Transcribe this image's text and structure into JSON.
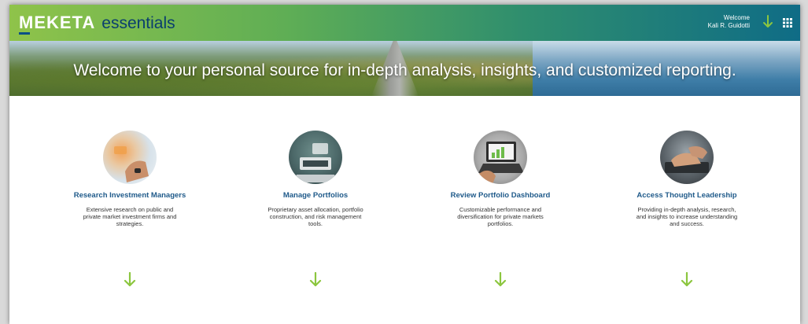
{
  "header": {
    "brand": "MEKETA",
    "product": "essentials",
    "welcome_label": "Welcome",
    "user_name": "Kali R. Guidotti"
  },
  "hero": {
    "title": "Welcome to your personal source for in-depth analysis, insights, and customized reporting."
  },
  "cards": [
    {
      "title": "Research Investment Managers",
      "description": "Extensive research on public and private market investment firms and strategies."
    },
    {
      "title": "Manage Portfolios",
      "description": "Proprietary asset allocation, portfolio construction, and risk management tools."
    },
    {
      "title": "Review Portfolio Dashboard",
      "description": "Customizable performance and diversification for private markets portfolios."
    },
    {
      "title": "Access Thought Leadership",
      "description": "Providing in-depth analysis, research, and insights to increase understanding and success."
    }
  ],
  "colors": {
    "accent_green": "#8cc63f",
    "title_blue": "#1f5a8a"
  }
}
